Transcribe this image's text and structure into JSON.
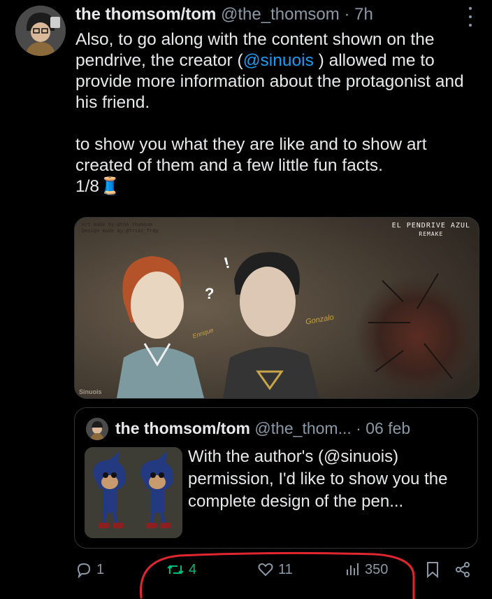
{
  "tweet": {
    "display_name": "the thomsom/tom",
    "handle": "@the_thomsom",
    "separator": "·",
    "time": "7h",
    "text": {
      "p1_before": "Also, to go along with the content shown on the pendrive, the creator (",
      "mention": "@sinuois",
      "p1_after": " ) allowed me to provide more information about the protagonist and his friend.",
      "p2": "to show you what they are like and to show art created of them and a few little fun facts.",
      "p3": "1/8",
      "emoji": "🧵"
    }
  },
  "media": {
    "credit_line1": "Art made by:@the_thomsom",
    "credit_line2": "Design made by:@Trikt_Trdy",
    "title": "EL PENDRIVE AZUL",
    "subtitle": "REMAKE",
    "label_left": "Enrique",
    "label_right": "Gonzalo",
    "question": "?",
    "exclaim": "!",
    "watermark": "Sinuois"
  },
  "quote": {
    "display_name": "the thomsom/tom",
    "handle": "@the_thom...",
    "separator": "·",
    "date": "06 feb",
    "text": "With the author's (@sinuois) permission, I'd like to show you the complete design of the pen..."
  },
  "actions": {
    "replies": "1",
    "retweets": "4",
    "likes": "11",
    "views": "350",
    "icons": [
      "reply-icon",
      "retweet-icon",
      "like-icon",
      "views-icon",
      "bookmark-icon",
      "share-icon"
    ]
  },
  "colors": {
    "accent": "#1d9bf0",
    "retweet": "#00ba7c",
    "muted": "#8b98a5",
    "annotation": "#e0262f"
  }
}
